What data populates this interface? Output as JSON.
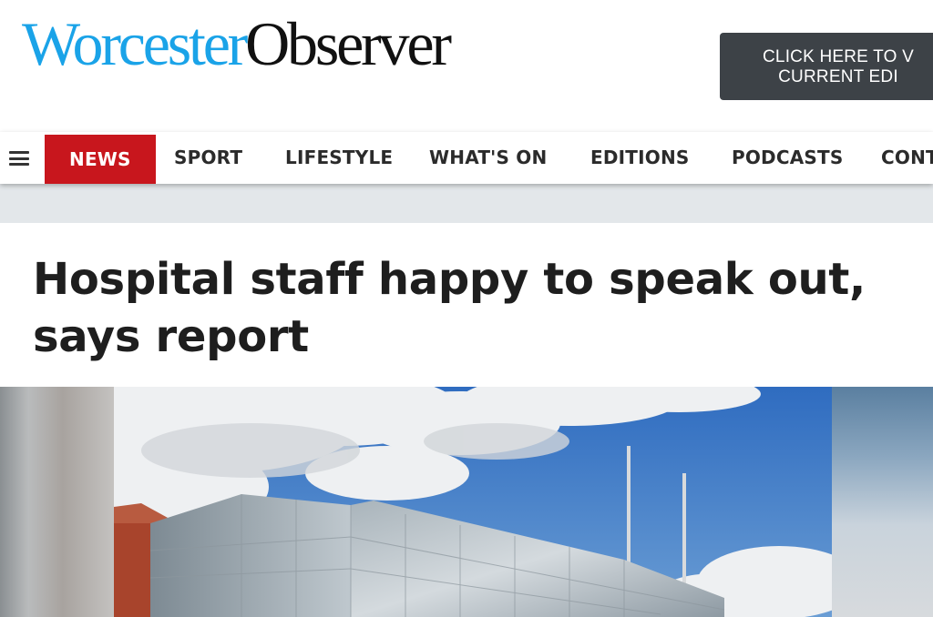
{
  "header": {
    "logo": {
      "part1": "Worcester",
      "part2": "Observer"
    },
    "edition_button": {
      "line1": "CLICK HERE TO V",
      "line2": "CURRENT EDI"
    }
  },
  "nav": {
    "menu_icon": "hamburger-icon",
    "items": [
      {
        "label": "NEWS",
        "active": true
      },
      {
        "label": "SPORT"
      },
      {
        "label": "LIFESTYLE"
      },
      {
        "label": "WHAT'S ON"
      },
      {
        "label": "EDITIONS"
      },
      {
        "label": "PODCASTS"
      },
      {
        "label": "CONT"
      }
    ],
    "active_color": "#c8161d"
  },
  "article": {
    "headline": "Hospital staff happy to speak out, says report",
    "hero_image": "hospital-building-photo"
  },
  "colors": {
    "logo_blue": "#1aa3e8",
    "logo_dark": "#111111",
    "button_bg": "#3d4247",
    "band_grey": "#e3e7ea"
  }
}
